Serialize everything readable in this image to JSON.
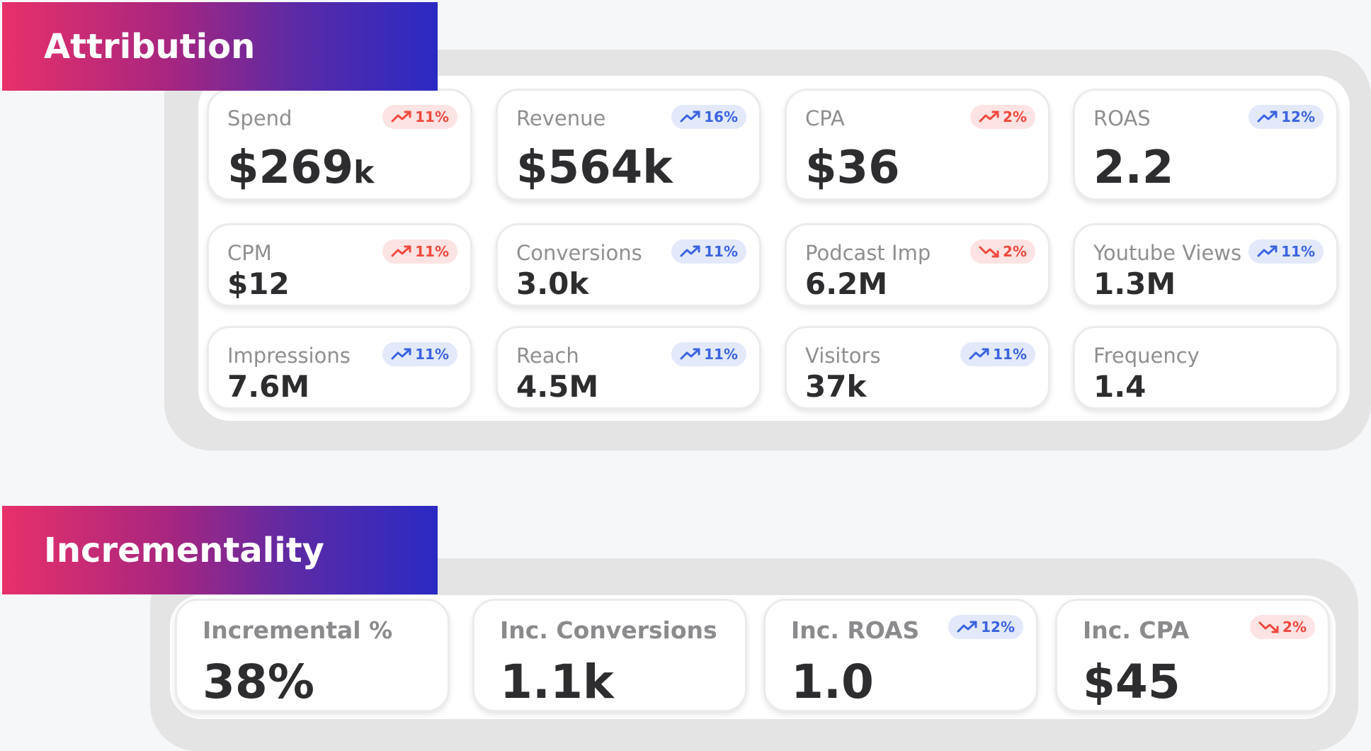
{
  "sections": {
    "attribution": {
      "title": "Attribution"
    },
    "incrementality": {
      "title": "Incrementality"
    }
  },
  "colors": {
    "banner_gradient": [
      "#e8306a",
      "#5a2aa6",
      "#2a2ac4"
    ],
    "trend_up_bad": "#f0493e",
    "trend_good": "#3b63e0",
    "text_primary": "#2d2d2f",
    "text_label": "#8f8f92"
  },
  "attribution_cards": [
    {
      "label": "Spend",
      "value": "$269",
      "suffix": "k",
      "badge": "11%",
      "trend": "up",
      "tone": "red"
    },
    {
      "label": "Revenue",
      "value": "$564k",
      "suffix": "",
      "badge": "16%",
      "trend": "up",
      "tone": "blue"
    },
    {
      "label": "CPA",
      "value": "$36",
      "suffix": "",
      "badge": "2%",
      "trend": "up",
      "tone": "red"
    },
    {
      "label": "ROAS",
      "value": "2.2",
      "suffix": "",
      "badge": "12%",
      "trend": "up",
      "tone": "blue"
    },
    {
      "label": "CPM",
      "value": "$12",
      "suffix": "",
      "badge": "11%",
      "trend": "up",
      "tone": "red"
    },
    {
      "label": "Conversions",
      "value": "3.0k",
      "suffix": "",
      "badge": "11%",
      "trend": "up",
      "tone": "blue"
    },
    {
      "label": "Podcast Imp",
      "value": "6.2M",
      "suffix": "",
      "badge": "2%",
      "trend": "down",
      "tone": "red"
    },
    {
      "label": "Youtube Views",
      "value": "1.3M",
      "suffix": "",
      "badge": "11%",
      "trend": "up",
      "tone": "blue"
    },
    {
      "label": "Impressions",
      "value": "7.6M",
      "suffix": "",
      "badge": "11%",
      "trend": "up",
      "tone": "blue"
    },
    {
      "label": "Reach",
      "value": "4.5M",
      "suffix": "",
      "badge": "11%",
      "trend": "up",
      "tone": "blue"
    },
    {
      "label": "Visitors",
      "value": "37k",
      "suffix": "",
      "badge": "11%",
      "trend": "up",
      "tone": "blue"
    },
    {
      "label": "Frequency",
      "value": "1.4",
      "suffix": "",
      "badge": "",
      "trend": "",
      "tone": ""
    }
  ],
  "incrementality_cards": [
    {
      "label": "Incremental %",
      "value": "38%",
      "badge": "",
      "trend": "",
      "tone": ""
    },
    {
      "label": "Inc. Conversions",
      "value": "1.1k",
      "badge": "",
      "trend": "",
      "tone": ""
    },
    {
      "label": "Inc. ROAS",
      "value": "1.0",
      "badge": "12%",
      "trend": "up",
      "tone": "blue"
    },
    {
      "label": "Inc. CPA",
      "value": "$45",
      "badge": "2%",
      "trend": "down",
      "tone": "red"
    }
  ],
  "icons": {
    "trend_up": "trending-up-icon",
    "trend_down": "trending-down-icon"
  }
}
